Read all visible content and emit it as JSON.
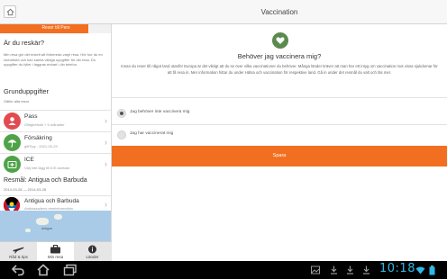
{
  "screen": {
    "title": "Vaccination"
  },
  "left_pane": {
    "top_tab_label": "Resor till Pers",
    "intro_heading": "Är du reskär?",
    "intro_text": "Min resa gör det enkelt att förbereda varje resa. Hör hur du en checklistö och kan samla viktiga uppgifter för din resa. Du uppgifter du fyller i laggras enbart i din telefon.",
    "section_heading": "Grunduppgifter",
    "section_sub": "Gäller alla resor",
    "items": [
      {
        "title": "Pass",
        "subtitle": "Giltighetstid + 6 månader",
        "icon": "passport-icon",
        "color": "#e24a50"
      },
      {
        "title": "Försäkring",
        "subtitle": "giffTipy - 2021-03-29",
        "icon": "umbrella-icon",
        "color": "#4ea347"
      },
      {
        "title": "ICE",
        "subtitle": "Välj inte lägg till ICE-kontakt",
        "icon": "medical-kit-icon",
        "color": "#4ea347"
      }
    ],
    "trip_heading": "Resmål: Antigua och Barbuda",
    "trip_dates": "2014-03-28 — 2014-03-28",
    "destination": {
      "title": "Antigua och Barbuda",
      "subtitle": "Ambassadens reseinformation",
      "icon": "flag-antigua-icon"
    },
    "map_label": "Antigua"
  },
  "tabs": [
    {
      "label": "Råd & tips",
      "icon": "airplane-icon"
    },
    {
      "label": "Min resa",
      "icon": "suitcase-icon",
      "selected": true
    },
    {
      "label": "Länder",
      "icon": "info-icon"
    }
  ],
  "main": {
    "question": "Behöver jag vaccinera mig?",
    "description": "Innan du reser till något land utanför Europa är det viktigt att du se över vilka vaccinationer du behöver. Många länder kräver att man har ett intyg om vaccination mot vissa sjukdomar för att få resa in. Mer information hittar du under Hälsa och vaccination för respektive land. Gå in under det resmål du valt och läs mer.",
    "options": [
      {
        "label": "Jag behöver inte vaccinera mig",
        "selected": true
      },
      {
        "label": "Jag har vaccinerat mig",
        "selected": false
      }
    ],
    "save_label": "Spara"
  },
  "system_bar": {
    "time": "10:18"
  },
  "colors": {
    "accent": "#f26f21",
    "heart": "#5a8a4e",
    "clock": "#2fb8e6"
  }
}
